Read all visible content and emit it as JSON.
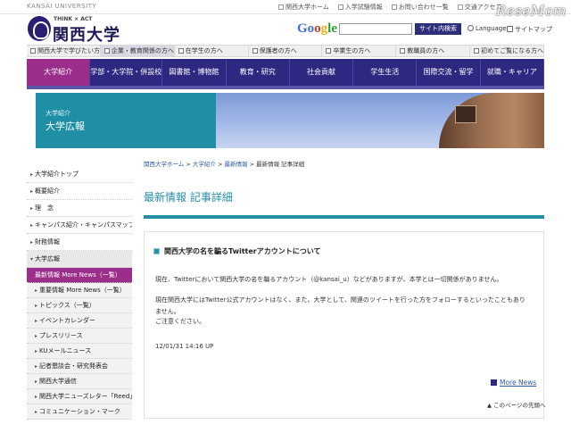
{
  "top": {
    "univ_en": "KANSAI UNIVERSITY",
    "utility": [
      "関西大学ホーム",
      "入学試験情報",
      "お問い合わせ一覧",
      "交通アクセス"
    ],
    "watermark": "ReseMom"
  },
  "header": {
    "tagline": "THINK × ACT",
    "univ_jp": "関西大学",
    "google": [
      "Go",
      "o",
      "g",
      "le"
    ],
    "search_placeholder": "",
    "search_button": "サイト内検索",
    "language": "Language",
    "sitemap": "サイトマップ"
  },
  "audience_nav": [
    "関西大学で学びたい方へ",
    "企業・教育関係の方へ",
    "在学生の方へ",
    "保護者の方へ",
    "卒業生の方へ",
    "教職員の方へ",
    "初めてご覧になる方へ"
  ],
  "main_nav": [
    "大学紹介",
    "学部・大学院・併設校",
    "図書館・博物館",
    "教育・研究",
    "社会貢献",
    "学生生活",
    "国際交流・留学",
    "就職・キャリア"
  ],
  "hero": {
    "sub": "大学紹介",
    "title": "大学広報"
  },
  "sidebar": {
    "items": [
      "大学紹介トップ",
      "概要紹介",
      "理　念",
      "キャンパス紹介・キャンパスマップ",
      "財務情報"
    ],
    "group_head": "大学広報",
    "sub_items": [
      "最新情報 More News（一覧）",
      "重要情報 More News（一覧）",
      "トピックス（一覧）",
      "イベントカレンダー",
      "プレスリリース",
      "KUメールニュース",
      "記者懇談会・研究発表会",
      "関西大学通信",
      "関西大学ニューズレター「Reed」",
      "コミュニケーション・マーク"
    ]
  },
  "content": {
    "breadcrumb": [
      "関西大学ホーム",
      "大学紹介",
      "最新情報",
      "最新情報 記事詳細"
    ],
    "page_title": "最新情報 記事詳細",
    "article_title": "関西大学の名を騙るTwitterアカウントについて",
    "para1": "現在、Twitterにおいて関西大学の名を騙るアカウント（@kansai_u）などがありますが、本学とは一切関係がありません。",
    "para2": "現在関西大学にはTwitter公式アカウントはなく、また、大学として、関連のツイートを行った方をフォローするといったこともありません。",
    "para3": "ご注意ください。",
    "date": "12/01/31 14:16 UP",
    "more_news": "More News",
    "page_top": "このページの先頭へ"
  },
  "colors": {
    "nav": "#2e2880",
    "active": "#9a2e8a",
    "accent": "#2590a8"
  }
}
